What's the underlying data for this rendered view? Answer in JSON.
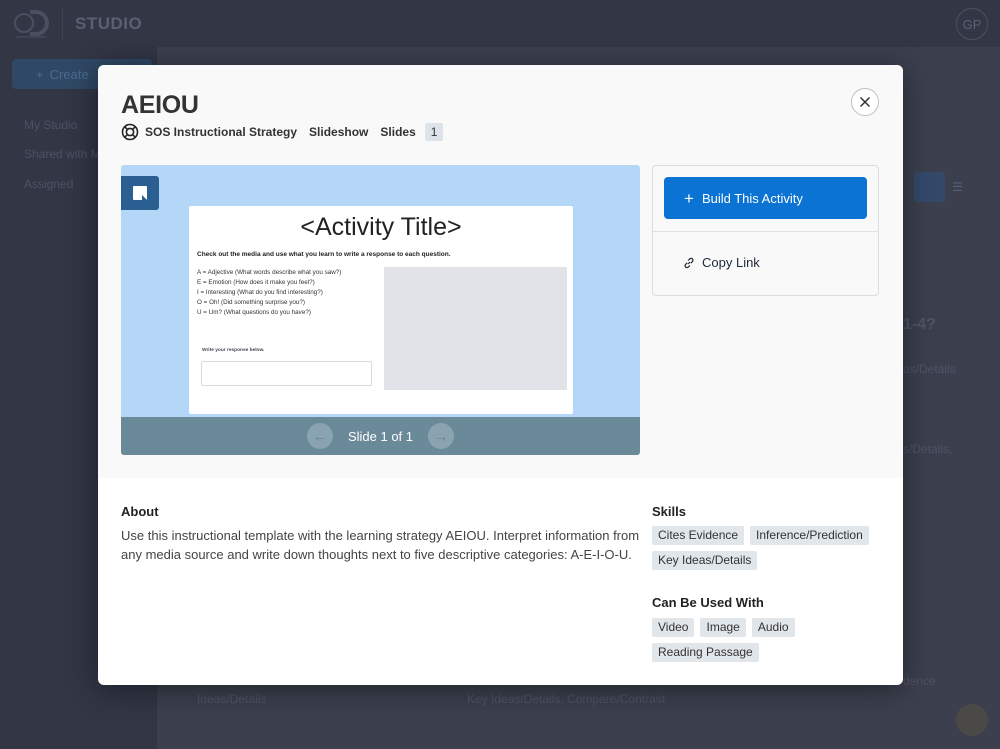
{
  "app": {
    "brand": "STUDIO",
    "avatar_initials": "GP",
    "create_label": "Create",
    "sidebar": [
      {
        "label": "My Studio"
      },
      {
        "label": "Shared with Me"
      },
      {
        "label": "Assigned"
      }
    ],
    "background_text": {
      "heading_right": "1-4?",
      "tags_right_1": "as/Details",
      "tags_right_2": "s/Details,",
      "bottom_left": "Ideas/Details",
      "bottom_mid": "Key Ideas/Details, Compare/Contrast",
      "bottom_right": "dence"
    }
  },
  "modal": {
    "title": "AEIOU",
    "category": "SOS Instructional Strategy",
    "type": "Slideshow",
    "slides_label": "Slides",
    "slides_count": "1",
    "close_label": "Close",
    "preview": {
      "slide_title": "<Activity Title>",
      "instruction": "Check out the media and use what you learn to write a response to each question.",
      "list": [
        "A = Adjective (What words describe what you saw?)",
        "E = Emotion (How does it make you feel?)",
        "I = Interesting (What do you find interesting?)",
        "O = Oh! (Did something surprise you?)",
        "U = Um? (What questions do you have?)"
      ],
      "response_label": "Write your response below.",
      "slide_indicator": "Slide 1 of 1"
    },
    "actions": {
      "build_label": "Build This Activity",
      "copy_label": "Copy Link"
    },
    "about": {
      "title": "About",
      "text": "Use this instructional template with the learning strategy AEIOU. Interpret information from any media source and write down thoughts next to five descriptive categories: A-E-I-O-U."
    },
    "skills": {
      "title": "Skills",
      "tags": [
        "Cites Evidence",
        "Inference/Prediction",
        "Key Ideas/Details"
      ]
    },
    "used_with": {
      "title": "Can Be Used With",
      "tags": [
        "Video",
        "Image",
        "Audio",
        "Reading Passage"
      ]
    }
  },
  "colors": {
    "primary": "#0b73d3",
    "preview_bg": "#b4d7f7",
    "preview_footer": "#6a8999",
    "tag_bg": "#e0e6ea"
  }
}
